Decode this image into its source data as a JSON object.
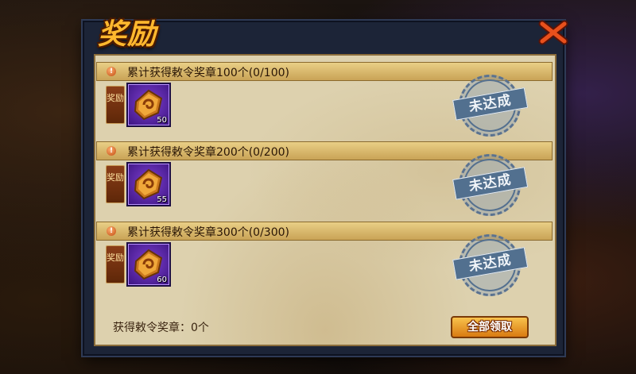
{
  "dialog": {
    "title": "奖励",
    "close_icon": "close-x-icon"
  },
  "tasks": [
    {
      "title": "累计获得敕令奖章100个(0/100)",
      "reward_label": "奖励",
      "item_icon": "command-medal-icon",
      "item_count": "50",
      "status": "未达成"
    },
    {
      "title": "累计获得敕令奖章200个(0/200)",
      "reward_label": "奖励",
      "item_icon": "command-medal-icon",
      "item_count": "55",
      "status": "未达成"
    },
    {
      "title": "累计获得敕令奖章300个(0/300)",
      "reward_label": "奖励",
      "item_icon": "command-medal-icon",
      "item_count": "60",
      "status": "未达成"
    }
  ],
  "footer": {
    "summary": "获得敕令奖章：0个",
    "claim_all_label": "全部领取"
  },
  "colors": {
    "title": "#ffb82e",
    "panel": "#ddd1ae",
    "header": "#d9b86c",
    "item_bg": "#5a2aa8",
    "stamp": "#52708f",
    "button": "#e89a2a"
  }
}
